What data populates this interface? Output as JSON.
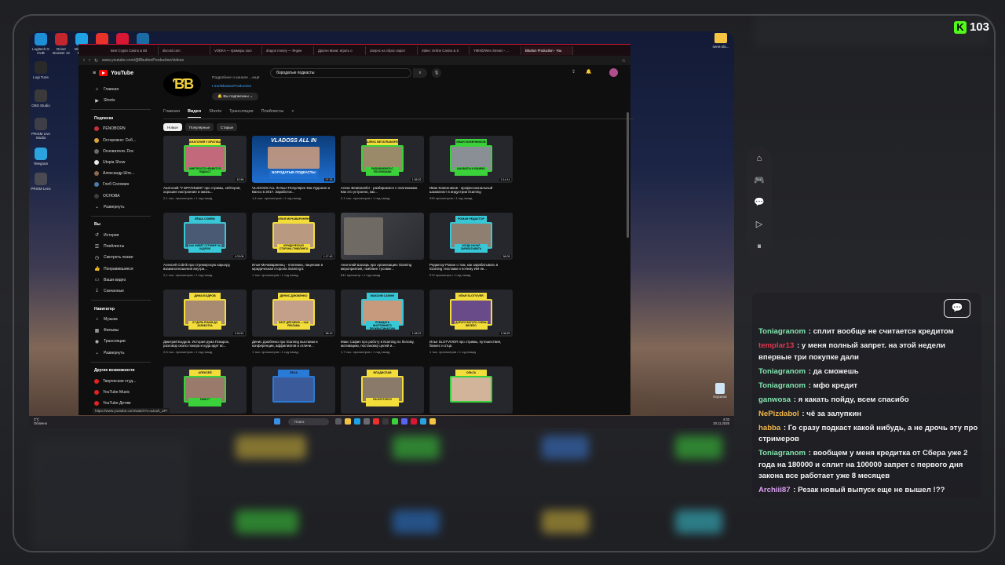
{
  "overlay": {
    "viewer_count": "103",
    "colors": {
      "kick_green": "#53fc18",
      "yt_red": "#ff0000"
    }
  },
  "desktop": {
    "icons": [
      {
        "label": "Logitech G HUB",
        "color": "#1e8fd6"
      },
      {
        "label": "Driver Booster 12",
        "color": "#c2272d"
      },
      {
        "label": "Microsoft Edge",
        "color": "#1fa1e5"
      },
      {
        "label": "Yandex",
        "color": "#e8322a"
      },
      {
        "label": "Opera GX",
        "color": "#d81734"
      },
      {
        "label": "Steam",
        "color": "#1b6ba4"
      },
      {
        "label": "Logi Tune",
        "color": "#2a2a2a"
      },
      {
        "label": "OBS Studio",
        "color": "#3a3a3a"
      },
      {
        "label": "PRISM Live Studio",
        "color": "#3e3e46"
      },
      {
        "label": "Telegram",
        "color": "#2aa3df"
      },
      {
        "label": "PRISM Lens",
        "color": "#4a4a52"
      }
    ],
    "folder_label": "seret-dis...",
    "trash_label": "Корзина"
  },
  "browser": {
    "tabs": [
      "Best Crypto Casino & Bit",
      "discord.com",
      "VODKA — примеры заго",
      "dragon money — Яндек",
      "Драгон Мани: играть о",
      "Запрос на сброс парол",
      "Stake: Online Casino & S",
      "YMIND/Wex Stream - ...",
      "Bbutton Production - You"
    ],
    "url": "www.youtube.com/@BbuttonProduction/videos"
  },
  "youtube": {
    "logo_text": "YouTube",
    "search_query": "бородатые подкасты",
    "sidebar": {
      "main": [
        {
          "label": "Главная",
          "icon": "home-icon",
          "glyph": "⌂"
        },
        {
          "label": "Shorts",
          "icon": "shorts-icon",
          "glyph": "▶"
        }
      ],
      "subs_title": "Подписки",
      "subs": [
        {
          "label": "PENOBORN",
          "color": "#c7303a"
        },
        {
          "label": "Осторожно: Соб...",
          "color": "#d9a43c"
        },
        {
          "label": "Основатели. Doc",
          "color": "#6a6a6a"
        },
        {
          "label": "Utopia Show",
          "color": "#e8e8e8"
        },
        {
          "label": "Александр Ште...",
          "color": "#8a6a52"
        },
        {
          "label": "Глеб Соломин",
          "color": "#4f7aa8"
        },
        {
          "label": "ОСНОВА",
          "color": "#3d3d3d"
        }
      ],
      "expand": "Развернуть",
      "you_title": "Вы",
      "you": [
        {
          "label": "История",
          "glyph": "↺",
          "icon": "history-icon"
        },
        {
          "label": "Плейлисты",
          "glyph": "☰",
          "icon": "playlists-icon"
        },
        {
          "label": "Смотреть позже",
          "glyph": "◷",
          "icon": "watch-later-icon"
        },
        {
          "label": "Понравившиеся",
          "glyph": "👍",
          "icon": "like-icon"
        },
        {
          "label": "Ваши видео",
          "glyph": "▭",
          "icon": "your-videos-icon"
        },
        {
          "label": "Скачанные",
          "glyph": "⤓",
          "icon": "downloads-icon"
        }
      ],
      "nav_title": "Навигатор",
      "nav": [
        {
          "label": "Музыка",
          "glyph": "♪",
          "icon": "music-icon"
        },
        {
          "label": "Фильмы",
          "glyph": "▦",
          "icon": "movies-icon"
        },
        {
          "label": "Трансляции",
          "glyph": "◉",
          "icon": "live-icon"
        },
        {
          "label": "Развернуть",
          "glyph": "⌄",
          "icon": "chevron-down-icon"
        }
      ],
      "more_title": "Другие возможности",
      "more": [
        "Творческая студ...",
        "YouTube Music",
        "YouTube Детям"
      ]
    },
    "channel": {
      "logo": "ƁƁ",
      "subtitle": "Подробнее о канале ...ещё",
      "link": "t.me/BbuttonProduction",
      "subscribed": "Вы подписаны"
    },
    "channel_tabs": [
      "Главная",
      "Видео",
      "Shorts",
      "Трансляции",
      "Плейлисты"
    ],
    "filters": [
      "Новые",
      "Популярные",
      "Старые"
    ],
    "videos": [
      {
        "title": "Анатолий \"У БРАТИШЕК\" про стримы, хейтеров, хорошее настроение и жизнь...",
        "meta": "2,1 тыс. просмотров • 1 год назад",
        "duration": "42:56",
        "label": "АНАТОЛИЙ У БРАТИШЕК",
        "caption": "МНЕ ПРОСТО НРАВИТСЯ ПОДКАСТ",
        "accent": "#3ad13a",
        "labelColor": "#f3dd3a",
        "face": "#c26a7c"
      },
      {
        "title": "VLADOSS ALL IN Был Популярен Как Лудожон и Вапсо в 2017. Заработок...",
        "meta": "1,4 тыс. просмотров • 1 год назад",
        "duration": "57:35",
        "label": "VLADOSS ALL IN",
        "caption": "БОРОДАТЫЕ ПОДКАСТЫ",
        "accent": "#2a7ad8",
        "labelColor": "#2a7ad8",
        "face": "#c89a7e",
        "special": true
      },
      {
        "title": "Алекс Betatransfer - разбираемся с платежками. Как это устроено, как...",
        "meta": "2,1 тыс. просмотров • 1 год назад",
        "duration": "1:36:02",
        "label": "АЛЕКС BETATRANSFER",
        "caption": "РАЗБИРАЕМСЯ С ПЛАТЕЖКАМИ",
        "accent": "#3ad13a",
        "labelColor": "#f3dd3a",
        "face": "#9a8a6a"
      },
      {
        "title": "Иван Коженников - профессиональный шахматист в индустрии iGaming",
        "meta": "930 просмотров • 1 год назад",
        "duration": "2:14:14",
        "label": "ИВАН КОЖЕННИКОВ",
        "caption": "ШАХМАТЫ И iGAMING",
        "accent": "#3ad13a",
        "labelColor": "#3ad13a",
        "face": "#8a8f96"
      },
      {
        "title": "Алексей Cobrik про стримерскую карьеру, взаимоотношения внутри...",
        "meta": "2,1 тыс. просмотров • 1 год назад",
        "duration": "1:03:06",
        "label": "ЛЁША COBRIK",
        "caption": "КАК ЖИВЁТ СТРИМЕР ЗА КАДРОМ",
        "accent": "#38c7d6",
        "labelColor": "#38c7d6",
        "face": "#4b5a74"
      },
      {
        "title": "Илья Мичаваринянц - платежки, лицензии и юридическая сторона iGaming'а",
        "meta": "1 тыс. просмотров • 1 год назад",
        "duration": "1:17:43",
        "label": "ИЛЬЯ МИЧАВАРИНЯНЦ",
        "caption": "ЮРИДИЧЕСКАЯ СТОРОНА ГЭМБЛИНГА",
        "accent": "#f3dd3a",
        "labelColor": "#f3dd3a",
        "face": "#b99a80"
      },
      {
        "title": "Анатолий Шохарь про организацию iGaming мероприятий, гэмблинг тусовке...",
        "meta": "641 просмотр • 1 год назад",
        "duration": "",
        "label": "",
        "caption": "",
        "accent": "#5b5e66",
        "labelColor": "#5b5e66",
        "face": "#6f6a64",
        "special2": true
      },
      {
        "title": "Редактор Роман о том, как зарабатывать в iGaming текстами и почему ИИ не...",
        "meta": "974 просмотра • 1 год назад",
        "duration": "58:05",
        "label": "РОМАН РЕДАКТОР",
        "caption": "КОГДА НАЧАЛ ЗАРАБАТЫВАТЬ",
        "accent": "#38c7d6",
        "labelColor": "#38c7d6",
        "face": "#8f7f70"
      },
      {
        "title": "Дмитрий Бодров. История рума Покарок, разговор около покера и куда идет вс...",
        "meta": "2,8 тыс. просмотров • 1 год назад",
        "duration": "1:24:51",
        "label": "ДИМА БОДРОВ",
        "caption": "ОТ ДЕЛА РУМОВ ДО ЗАРАБОТКА",
        "accent": "#f3dd3a",
        "labelColor": "#f3dd3a",
        "face": "#a88a72"
      },
      {
        "title": "Денис Дзюбенко про iGaming выставки и конференции, аффилиатов и отличи...",
        "meta": "1 тыс. просмотров • 1 год назад",
        "duration": "58:13",
        "label": "ДЕНИС ДЗЮБЕНКО",
        "caption": "БЕСТ ДЛЯ МЕНЯ — КАК РЕКЛАМА",
        "accent": "#f3dd3a",
        "labelColor": "#f3dd3a",
        "face": "#c4a08a"
      },
      {
        "title": "Макс Сафин про работу в iGaming по белому, мотивацию, постановку целей и...",
        "meta": "1,7 тыс. просмотров • 1 год назад",
        "duration": "1:08:23",
        "label": "МАКСИМ САФИН",
        "caption": "ПОБЕДИТЬ ВНУТРЕННЕГО ПРОКРАСТИНАТОРА",
        "accent": "#38c7d6",
        "labelColor": "#38c7d6",
        "face": "#c79a7e"
      },
      {
        "title": "Илья SLOTVIVER про стримы, путешествия, бизнес и отца",
        "meta": "1 тыс. просмотров • 1 год назад",
        "duration": "1:08:25",
        "label": "ИЛЬЯ SLOTVIVER",
        "caption": "ДОРОГО БОГАТО ОЧЕНЬ ВЕСЕЛО",
        "accent": "#f3dd3a",
        "labelColor": "#f3dd3a",
        "face": "#6a4b8a"
      },
      {
        "title": "",
        "meta": "",
        "duration": "",
        "label": "АЛЕКСЕЙ",
        "caption": "FAKE IT",
        "accent": "#3ad13a",
        "labelColor": "#f3dd3a",
        "face": "#9a7a6a"
      },
      {
        "title": "",
        "meta": "",
        "duration": "",
        "label": "ЛЕХА",
        "caption": "",
        "accent": "#2a7ad8",
        "labelColor": "#2a7ad8",
        "face": "#3a5a9a"
      },
      {
        "title": "",
        "meta": "",
        "duration": "",
        "label": "ВЛАДИСЛАВ",
        "caption": "РАСКРУТИЛСЯ",
        "accent": "#f3dd3a",
        "labelColor": "#f3dd3a",
        "face": "#8a7a6a"
      },
      {
        "title": "",
        "meta": "",
        "duration": "",
        "label": "ОЛЬГА",
        "caption": "",
        "accent": "#3ad13a",
        "labelColor": "#f3dd3a",
        "face": "#d2b49a"
      }
    ],
    "status_url": "https://www.youtube.com/watch?v=aJouh_aPl"
  },
  "taskbar": {
    "weather_temp": "3°C",
    "weather_desc": "Облачно",
    "search": "Поиск",
    "time": "4:33",
    "date": "20.11.2025"
  },
  "chat": {
    "messages": [
      {
        "user": "Toniagranom",
        "color": "#84e6b0",
        "text": "сплит вообще не считается кредитом"
      },
      {
        "user": "templar13",
        "color": "#e0364c",
        "text": "у меня полный запрет. на этой недели впервые три покупке дали"
      },
      {
        "user": "Toniagranom",
        "color": "#84e6b0",
        "text": "да сможешь"
      },
      {
        "user": "Toniagranom",
        "color": "#84e6b0",
        "text": "мфо кредит"
      },
      {
        "user": "ganwosa",
        "color": "#84e6b0",
        "text": "я какать пойду, всем спасибо"
      },
      {
        "user": "NePizdabol",
        "color": "#f2b64a",
        "text": "чё за залупкин"
      },
      {
        "user": "habba",
        "color": "#f2b64a",
        "text": "Го сразу подкаст какой нибудь, а не дрочь эту про стримеров"
      },
      {
        "user": "Toniagranom",
        "color": "#84e6b0",
        "text": "вообщем у меня кредитка от Сбера уже 2 года на 180000 и сплит на 100000 запрет с первого дня закона все работает уже 8 месяцев"
      },
      {
        "user": "Archiii87",
        "color": "#d9a0f0",
        "text": "Резак новый выпуск еще не вышел !??"
      }
    ]
  }
}
